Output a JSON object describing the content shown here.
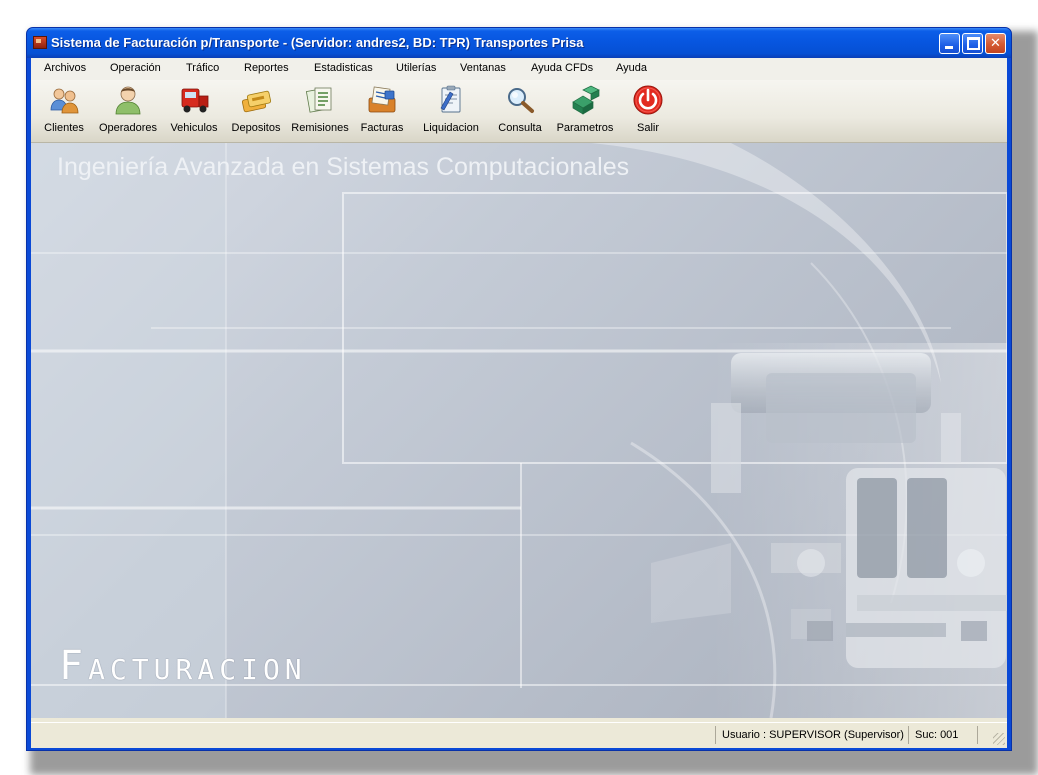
{
  "window": {
    "title": "Sistema de Facturación p/Transporte - (Servidor: andres2, BD: TPR) Transportes Prisa"
  },
  "menu": [
    "Archivos",
    "Operación",
    "Tráfico",
    "Reportes",
    "Estadisticas",
    "Utilerías",
    "Ventanas",
    "Ayuda CFDs",
    "Ayuda"
  ],
  "toolbar": [
    {
      "label": "Clientes",
      "icon": "clients-icon"
    },
    {
      "label": "Operadores",
      "icon": "operator-icon"
    },
    {
      "label": "Vehiculos",
      "icon": "truck-icon"
    },
    {
      "label": "Depositos",
      "icon": "deposit-icon"
    },
    {
      "label": "Remisiones",
      "icon": "remission-icon"
    },
    {
      "label": "Facturas",
      "icon": "invoice-icon"
    },
    {
      "label": "Liquidacion",
      "icon": "liquidation-icon"
    },
    {
      "label": "Consulta",
      "icon": "magnifier-icon"
    },
    {
      "label": "Parametros",
      "icon": "parameters-icon"
    },
    {
      "label": "Salir",
      "icon": "power-icon"
    }
  ],
  "desktop": {
    "slogan": "Ingeniería Avanzada en Sistemas Computacionales",
    "title": "Facturacion"
  },
  "status": {
    "user": "Usuario : SUPERVISOR  (Supervisor)",
    "branch": "Suc: 001"
  },
  "colors": {
    "titlebar": "#0756e0",
    "desktop": "#c4cbd6",
    "exit": "#e22a20"
  }
}
